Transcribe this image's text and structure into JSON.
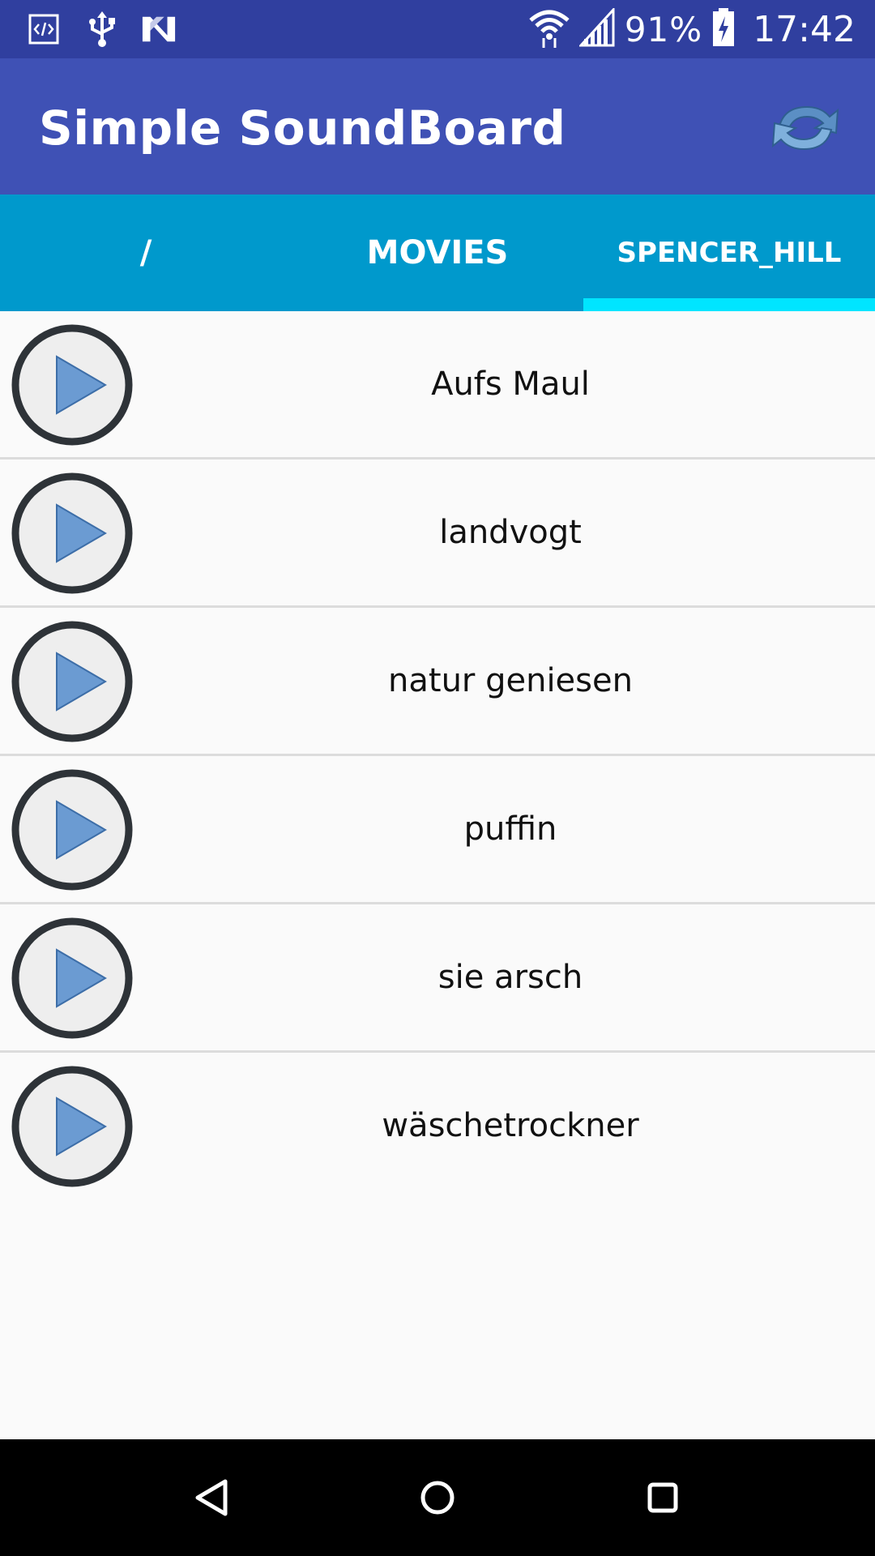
{
  "status_bar": {
    "icons": [
      "code-icon",
      "usb-icon",
      "n-notification-icon",
      "wifi-icon",
      "cell-signal-icon",
      "battery-charging-icon"
    ],
    "battery_text": "91%",
    "time": "17:42"
  },
  "app_bar": {
    "title": "Simple SoundBoard",
    "action_icon": "refresh-icon"
  },
  "tabs": [
    {
      "label": "/",
      "selected": false
    },
    {
      "label": "MOVIES",
      "selected": false
    },
    {
      "label": "SPENCER_HILL",
      "selected": true
    }
  ],
  "sounds": [
    {
      "label": "Aufs Maul"
    },
    {
      "label": "landvogt"
    },
    {
      "label": "natur geniesen"
    },
    {
      "label": "puffin"
    },
    {
      "label": "sie arsch"
    },
    {
      "label": "wäschetrockner"
    }
  ],
  "nav_bar": {
    "icons": [
      "back-icon",
      "home-icon",
      "recents-icon"
    ]
  },
  "colors": {
    "status_bar": "#303f9f",
    "app_bar": "#3f51b5",
    "tab_bar": "#0099cc",
    "tab_indicator": "#00e5ff",
    "play_triangle": "#6b9bd2"
  }
}
